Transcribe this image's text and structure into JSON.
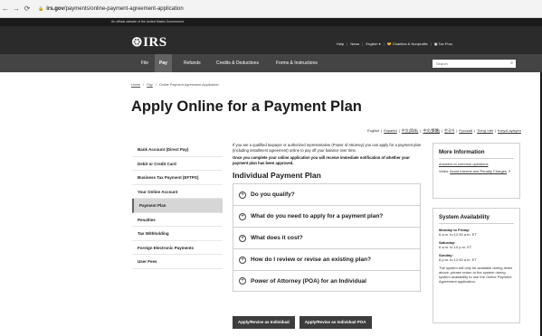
{
  "browser": {
    "back_icon": "back-arrow-icon",
    "forward_icon": "forward-arrow-icon",
    "reload_icon": "reload-icon",
    "lock_icon": "lock-icon",
    "url_domain": "irs.gov",
    "url_path": "/payments/online-payment-agreement-application"
  },
  "gov_banner": "An official website of the United States Government",
  "header": {
    "logo": "IRS",
    "help": "Help",
    "news": "News",
    "language": "English",
    "charities": "Charities & Nonprofits",
    "tax_pros": "Tax Pros"
  },
  "nav": {
    "items": [
      "File",
      "Pay",
      "Refunds",
      "Credits & Deductions",
      "Forms & Instructions"
    ],
    "search_placeholder": "Search"
  },
  "breadcrumb": [
    "Home",
    "Pay",
    "Online Payment Agreement Application"
  ],
  "title": "Apply Online for a Payment Plan",
  "languages": [
    "English",
    "Español",
    "中文(简体)",
    "中文(繁體)",
    "한국어",
    "Русский",
    "Tiếng Việt",
    "Kreyòl ayisyen"
  ],
  "sidebar": {
    "items": [
      "Bank Account (Direct Pay)",
      "Debit or Credit Card",
      "Business Tax Payment (EFTPS)",
      "Your Online Account",
      "Payment Plan",
      "Penalties",
      "Tax Withholding",
      "Foreign Electronic Payments",
      "User Fees"
    ],
    "active": "Payment Plan"
  },
  "content": {
    "intro": "If you are a qualified taxpayer or authorized representative (Power of Attorney) you can apply for a payment plan (including installment agreement) online to pay off your balance over time.",
    "notice": "Once you complete your online application you will receive immediate notification of whether your payment plan has been approved.",
    "section_title": "Individual Payment Plan",
    "accordion": [
      "Do you qualify?",
      "What do you need to apply for a payment plan?",
      "What does it cost?",
      "How do I review or revise an existing plan?",
      "Power of Attorney (POA) for an Individual"
    ]
  },
  "buttons": {
    "individual": "Apply/Revise as Individual",
    "poa": "Apply/Revise as Individual POA"
  },
  "more_info": {
    "title": "More Information",
    "link1": "Answers to common questions",
    "video_prefix": "Video:",
    "video_link": "Avoid Interest and Penalty Charges"
  },
  "availability": {
    "title": "System Availability",
    "rows": [
      {
        "day": "Monday to Friday:",
        "hours": "6 a.m. to 12:30 a.m. ET"
      },
      {
        "day": "Saturday:",
        "hours": "6 a.m. to 10 p.m. ET"
      },
      {
        "day": "Sunday:",
        "hours": "6 p.m. to 12:00 a.m. ET"
      }
    ],
    "note": "The system will only be available during times above; please return to the system during system availability to use the Online Payment Agreement application."
  }
}
